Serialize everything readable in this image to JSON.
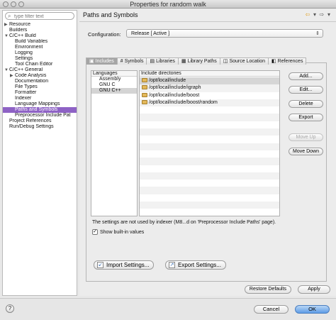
{
  "window": {
    "title": "Properties for random walk"
  },
  "sidebar": {
    "filter_placeholder": "type filter text",
    "items": [
      {
        "label": "Resource",
        "twisty": "▶",
        "indent": 0
      },
      {
        "label": "Builders",
        "twisty": "",
        "indent": 0
      },
      {
        "label": "C/C++ Build",
        "twisty": "▼",
        "indent": 0
      },
      {
        "label": "Build Variables",
        "twisty": "",
        "indent": 1
      },
      {
        "label": "Environment",
        "twisty": "",
        "indent": 1
      },
      {
        "label": "Logging",
        "twisty": "",
        "indent": 1
      },
      {
        "label": "Settings",
        "twisty": "",
        "indent": 1
      },
      {
        "label": "Tool Chain Editor",
        "twisty": "",
        "indent": 1
      },
      {
        "label": "C/C++ General",
        "twisty": "▼",
        "indent": 0
      },
      {
        "label": "Code Analysis",
        "twisty": "▶",
        "indent": 1
      },
      {
        "label": "Documentation",
        "twisty": "",
        "indent": 1
      },
      {
        "label": "File Types",
        "twisty": "",
        "indent": 1
      },
      {
        "label": "Formatter",
        "twisty": "",
        "indent": 1
      },
      {
        "label": "Indexer",
        "twisty": "",
        "indent": 1
      },
      {
        "label": "Language Mappings",
        "twisty": "",
        "indent": 1
      },
      {
        "label": "Paths and Symbols",
        "twisty": "",
        "indent": 1,
        "selected": true
      },
      {
        "label": "Preprocessor Include Pat",
        "twisty": "",
        "indent": 1
      },
      {
        "label": "Project References",
        "twisty": "",
        "indent": 0
      },
      {
        "label": "Run/Debug Settings",
        "twisty": "",
        "indent": 0
      }
    ]
  },
  "header": {
    "title": "Paths and Symbols",
    "icons": [
      "back-arrow-icon",
      "back-menu-icon",
      "forward-arrow-icon",
      "forward-menu-icon"
    ]
  },
  "configuration": {
    "label": "Configuration:",
    "value": "Release  [ Active ]"
  },
  "tabs": [
    {
      "label": "Includes",
      "icon": "includes-icon",
      "active": true
    },
    {
      "label": "Symbols",
      "icon": "hash-icon"
    },
    {
      "label": "Libraries",
      "icon": "libraries-icon"
    },
    {
      "label": "Library Paths",
      "icon": "library-paths-icon"
    },
    {
      "label": "Source Location",
      "icon": "source-location-icon"
    },
    {
      "label": "References",
      "icon": "references-icon"
    }
  ],
  "languages": {
    "header": "Languages",
    "items": [
      "Assembly",
      "GNU C",
      "GNU C++"
    ],
    "selected_index": 2
  },
  "include_dirs": {
    "header": "Include directories",
    "items": [
      "/opt/local/include",
      "/opt/local/include/igraph",
      "/opt/local/include/boost",
      "/opt/local/include/boost/random"
    ]
  },
  "side_buttons": {
    "add": "Add...",
    "edit": "Edit...",
    "delete": "Delete",
    "export": "Export",
    "move_up": "Move Up",
    "move_down": "Move Down"
  },
  "note": "The settings are not used by indexer (M8...d on 'Preprocessor Include Paths' page).",
  "show_builtin": {
    "label": "Show built-in values",
    "checked": true
  },
  "import_button": "Import Settings...",
  "export_button": "Export Settings...",
  "restore_defaults": "Restore Defaults",
  "apply": "Apply",
  "cancel": "Cancel",
  "ok": "OK",
  "help": "?"
}
